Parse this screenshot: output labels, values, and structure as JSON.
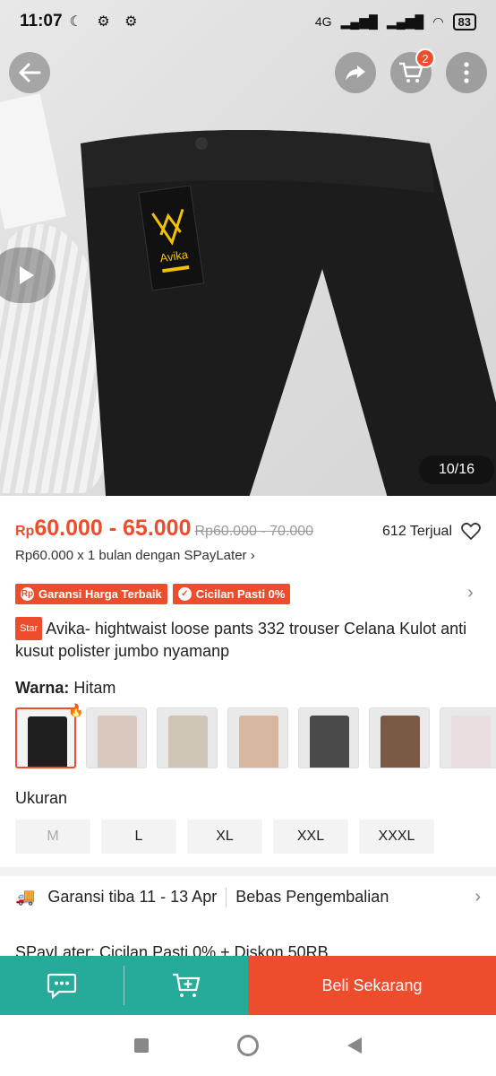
{
  "status_bar": {
    "time": "11:07",
    "network": "4G",
    "battery": "83"
  },
  "header": {
    "cart_count": "2"
  },
  "media": {
    "counter": "10/16",
    "brand_tag": "Avika"
  },
  "price": {
    "currency": "Rp",
    "range": "60.000 - 65.000",
    "original": "Rp60.000 - 70.000",
    "sold": "612 Terjual",
    "paylater": "Rp60.000 x 1 bulan dengan SPayLater"
  },
  "tags": [
    {
      "label": "Garansi Harga Terbaik",
      "icon": "rp-icon"
    },
    {
      "label": "Cicilan Pasti 0%",
      "icon": "check-icon"
    }
  ],
  "product": {
    "badge": "Star",
    "title": "Avika- hightwaist loose pants 332 trouser Celana Kulot anti kusut polister jumbo nyamanp"
  },
  "variant": {
    "color_label": "Warna:",
    "color_value": "Hitam",
    "swatch_colors": [
      "#1f1f1f",
      "#d9c8bd",
      "#cfc6b8",
      "#d8b7a0",
      "#4a4a4a",
      "#7a5a44",
      "#e9dedf"
    ],
    "size_label": "Ukuran",
    "sizes": [
      "M",
      "L",
      "XL",
      "XXL",
      "XXXL"
    ]
  },
  "shipping": {
    "guarantee": "Garansi tiba 11 - 13 Apr",
    "returns": "Bebas Pengembalian"
  },
  "spaylater_promo": "SPayLater: Cicilan Pasti 0% + Diskon 50RB",
  "bottom": {
    "buy_label": "Beli Sekarang"
  },
  "colors": {
    "accent": "#ee4d2d",
    "teal": "#26aa99"
  }
}
